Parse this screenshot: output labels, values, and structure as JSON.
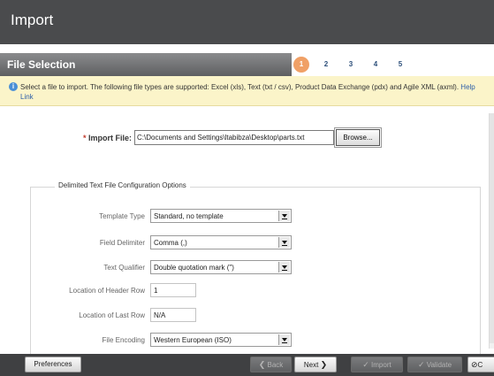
{
  "header": {
    "title": "Import"
  },
  "steps": {
    "section_title": "File Selection",
    "items": [
      {
        "label": "1",
        "active": true
      },
      {
        "label": "2",
        "active": false
      },
      {
        "label": "3",
        "active": false
      },
      {
        "label": "4",
        "active": false
      },
      {
        "label": "5",
        "active": false
      }
    ]
  },
  "notice": {
    "text": "Select a file to import. The following file types are supported: Excel (xls), Text (txt / csv), Product Data Exchange (pdx) and Agile XML (axml). ",
    "help_link": "Help Link",
    "icon": "info-icon"
  },
  "file": {
    "required_mark": "*",
    "label": "Import File:",
    "value": "C:\\Documents and Settings\\ltabibza\\Desktop\\parts.txt",
    "browse_label": "Browse..."
  },
  "options": {
    "legend": "Delimited Text File Configuration Options",
    "template_type": {
      "label": "Template Type",
      "value": "Standard, no template"
    },
    "field_delimiter": {
      "label": "Field Delimiter",
      "value": "Comma (,)"
    },
    "text_qualifier": {
      "label": "Text Qualifier",
      "value": "Double quotation mark (\")"
    },
    "header_row": {
      "label": "Location of Header Row",
      "value": "1"
    },
    "last_row": {
      "label": "Location of Last Row",
      "value": "N/A"
    },
    "file_encoding": {
      "label": "File Encoding",
      "value": "Western European (ISO)"
    }
  },
  "footer": {
    "preferences": "Preferences",
    "back": "Back",
    "next": "Next",
    "import": "Import",
    "validate": "Validate",
    "cancel": "C"
  },
  "colors": {
    "header_bg": "#4a4b4d",
    "active_step": "#f0a066",
    "notice_bg": "#fbf4c9",
    "link": "#2c5ea8"
  }
}
